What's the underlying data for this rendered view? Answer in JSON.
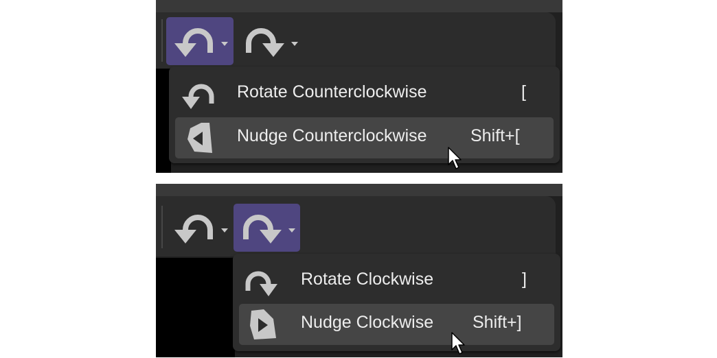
{
  "colors": {
    "menu_bg": "#2d2d2d",
    "menu_hover": "#454545",
    "toolbar_bg": "#2c2c2c",
    "active_button": "#4f4680",
    "text": "#ededed",
    "icon": "#c8c8c8"
  },
  "panels": [
    {
      "active_button": "rotate-counterclockwise",
      "menu": [
        {
          "label": "Rotate Counterclockwise",
          "shortcut": "[",
          "icon": "rotate-counterclockwise-icon",
          "hovered": false
        },
        {
          "label": "Nudge Counterclockwise",
          "shortcut": "Shift+[",
          "icon": "nudge-counterclockwise-icon",
          "hovered": true
        }
      ]
    },
    {
      "active_button": "rotate-clockwise",
      "menu": [
        {
          "label": "Rotate Clockwise",
          "shortcut": "]",
          "icon": "rotate-clockwise-icon",
          "hovered": false
        },
        {
          "label": "Nudge Clockwise",
          "shortcut": "Shift+]",
          "icon": "nudge-clockwise-icon",
          "hovered": true
        }
      ]
    }
  ]
}
